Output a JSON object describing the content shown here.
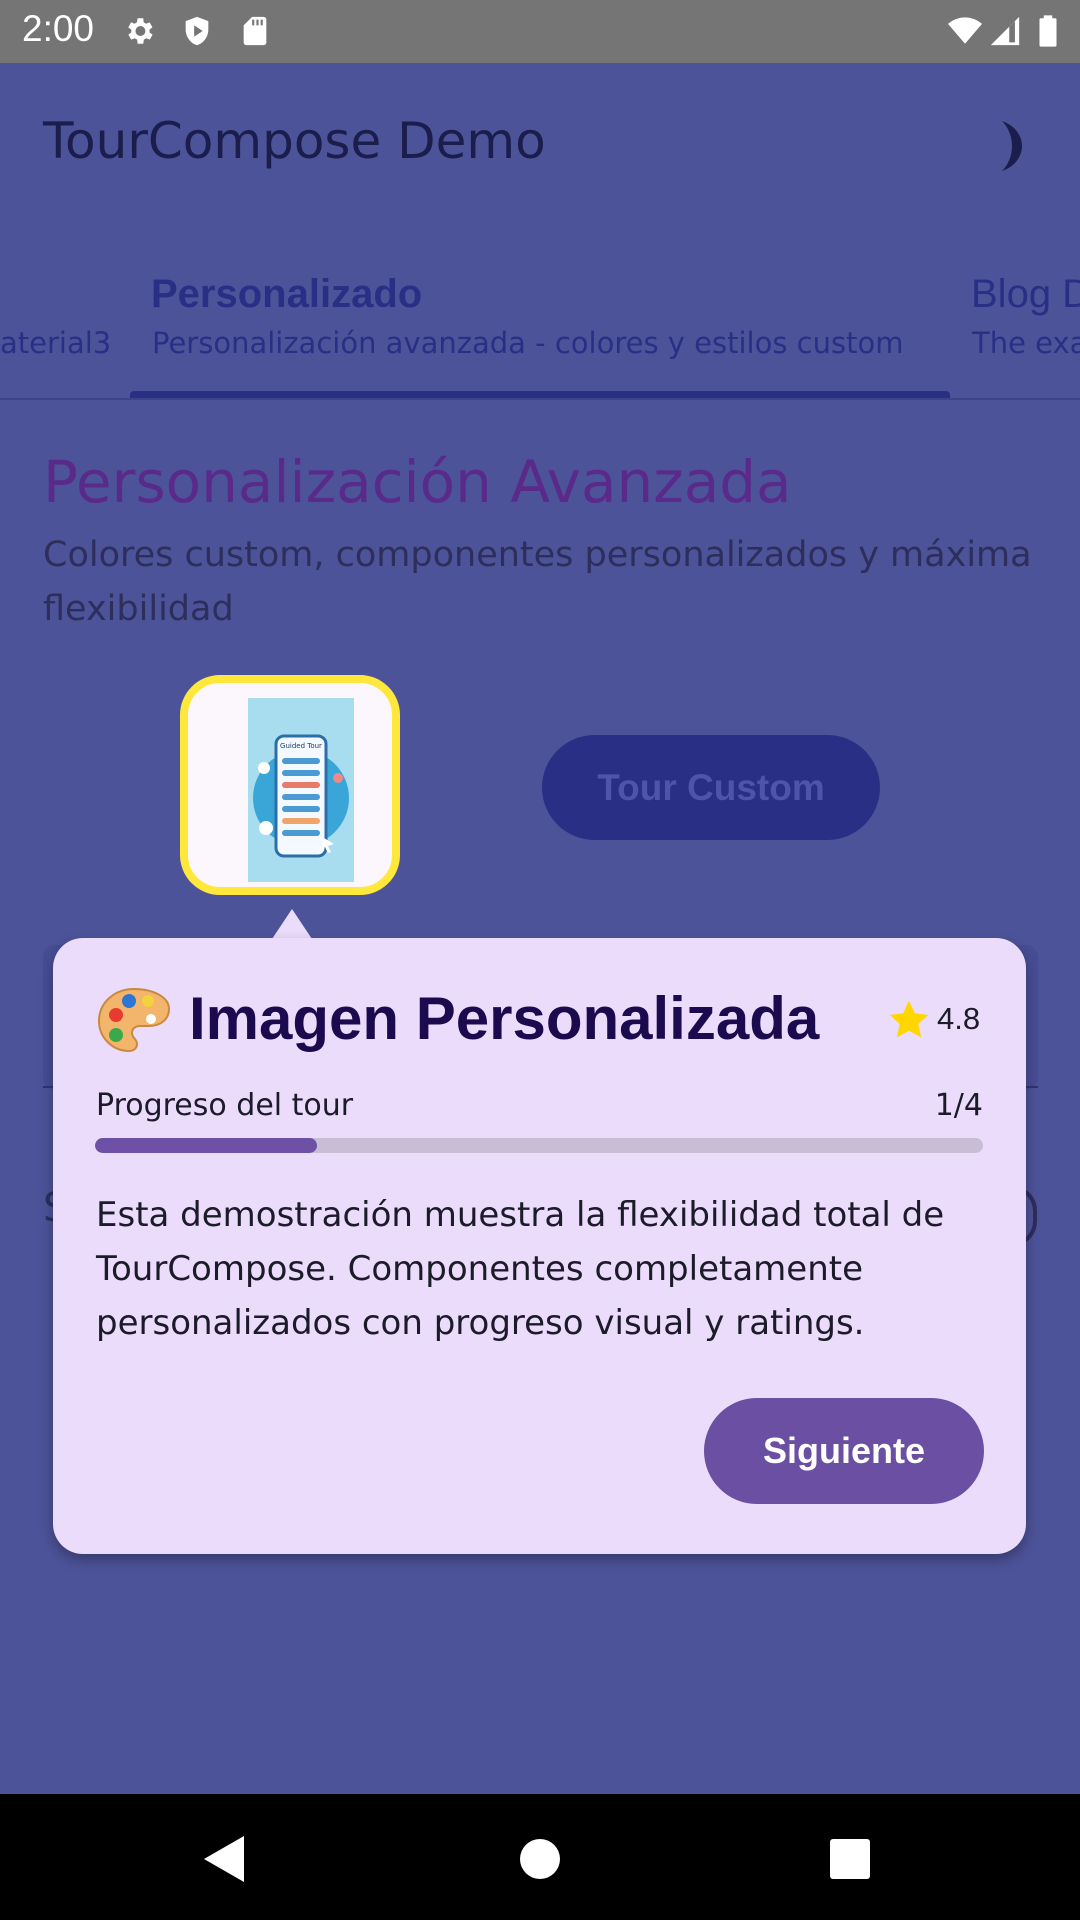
{
  "status_bar": {
    "time": "2:00",
    "icons_left": [
      "settings-icon",
      "shield-icon",
      "sd-card-icon"
    ],
    "icons_right": [
      "wifi-icon",
      "signal-icon",
      "battery-icon"
    ]
  },
  "app_bar": {
    "title": "TourCompose Demo",
    "theme_toggle_icon": "moon-icon"
  },
  "tabs": [
    {
      "title": "",
      "subtitle": "aterial3"
    },
    {
      "title": "Personalizado",
      "subtitle": "Personalización avanzada - colores y estilos custom",
      "selected": true
    },
    {
      "title": "Blog D",
      "subtitle": "The exa"
    }
  ],
  "section": {
    "title": "Personalización Avanzada",
    "description": "Colores custom, componentes personalizados y máxima flexibilidad"
  },
  "thumbnail": {
    "caption": "Guided Tour"
  },
  "tour_button": {
    "label": "Tour Custom"
  },
  "background_partial": {
    "letter": "S"
  },
  "tooltip": {
    "icon": "palette-icon",
    "title": "Imagen Personalizada",
    "rating_icon": "star-icon",
    "rating": "4.8",
    "progress_label": "Progreso del tour",
    "progress_count": "1/4",
    "progress_fraction": 0.25,
    "body": "Esta demostración muestra la flexibilidad total de TourCompose. Componentes completamente personalizados con progreso visual y ratings.",
    "next_label": "Siguiente"
  },
  "colors": {
    "scrim_background": "#4d5399",
    "tooltip_background": "#ebdcfb",
    "accent": "#6a4fa3",
    "highlight_border": "#ffe83b",
    "star": "#ffd600"
  },
  "nav_bar": {
    "buttons": [
      "back-icon",
      "home-icon",
      "recents-icon"
    ]
  }
}
